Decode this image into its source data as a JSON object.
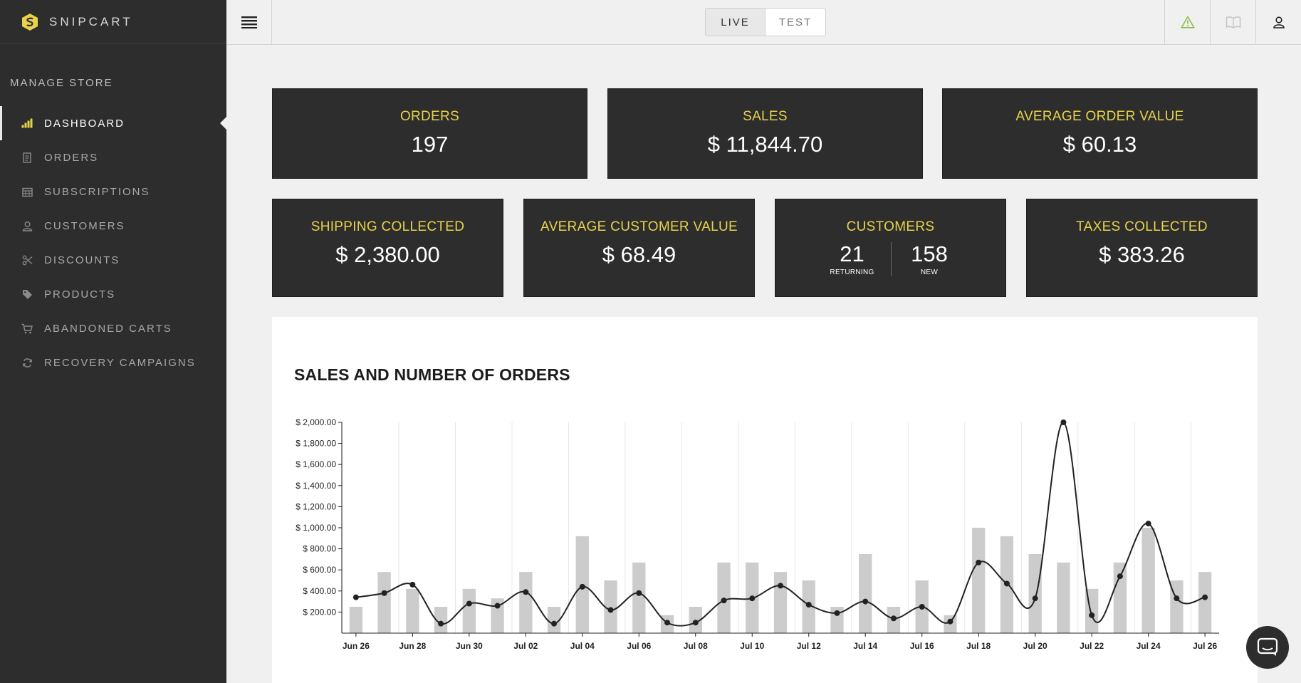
{
  "brand": {
    "name": "SNIPCART",
    "accent": "#e8d24a"
  },
  "sidebar": {
    "section_title": "MANAGE STORE",
    "items": [
      {
        "label": "DASHBOARD",
        "icon": "bar-chart-icon",
        "active": true
      },
      {
        "label": "ORDERS",
        "icon": "receipt-icon"
      },
      {
        "label": "SUBSCRIPTIONS",
        "icon": "calendar-icon"
      },
      {
        "label": "CUSTOMERS",
        "icon": "user-icon"
      },
      {
        "label": "DISCOUNTS",
        "icon": "scissors-icon"
      },
      {
        "label": "PRODUCTS",
        "icon": "tag-icon"
      },
      {
        "label": "ABANDONED CARTS",
        "icon": "cart-icon"
      },
      {
        "label": "RECOVERY CAMPAIGNS",
        "icon": "refresh-icon"
      }
    ]
  },
  "topbar": {
    "mode_live": "LIVE",
    "mode_test": "TEST",
    "selected_mode": "LIVE",
    "icons": [
      "warning-icon",
      "book-icon",
      "user-icon"
    ]
  },
  "stats": {
    "orders": {
      "label": "ORDERS",
      "value": "197"
    },
    "sales": {
      "label": "SALES",
      "value": "$ 11,844.70"
    },
    "aov": {
      "label": "AVERAGE ORDER VALUE",
      "value": "$ 60.13"
    },
    "shipping": {
      "label": "SHIPPING COLLECTED",
      "value": "$ 2,380.00"
    },
    "acv": {
      "label": "AVERAGE CUSTOMER VALUE",
      "value": "$ 68.49"
    },
    "customers": {
      "label": "CUSTOMERS",
      "returning": "21",
      "returning_label": "RETURNING",
      "new": "158",
      "new_label": "NEW"
    },
    "taxes": {
      "label": "TAXES COLLECTED",
      "value": "$ 383.26"
    }
  },
  "chart_title": "SALES AND NUMBER OF ORDERS",
  "chart_data": {
    "type": "bar",
    "title": "SALES AND NUMBER OF ORDERS",
    "x": [
      "Jun 26",
      "Jun 27",
      "Jun 28",
      "Jun 29",
      "Jun 30",
      "Jul 01",
      "Jul 02",
      "Jul 03",
      "Jul 04",
      "Jul 05",
      "Jul 06",
      "Jul 07",
      "Jul 08",
      "Jul 09",
      "Jul 10",
      "Jul 11",
      "Jul 12",
      "Jul 13",
      "Jul 14",
      "Jul 15",
      "Jul 16",
      "Jul 17",
      "Jul 18",
      "Jul 19",
      "Jul 20",
      "Jul 21",
      "Jul 22",
      "Jul 23",
      "Jul 24",
      "Jul 25",
      "Jul 26"
    ],
    "x_tick_labels": [
      "Jun 26",
      "Jun 28",
      "Jun 30",
      "Jul 02",
      "Jul 04",
      "Jul 06",
      "Jul 08",
      "Jul 10",
      "Jul 12",
      "Jul 14",
      "Jul 16",
      "Jul 18",
      "Jul 20",
      "Jul 22",
      "Jul 24",
      "Jul 26"
    ],
    "y_tick_labels": [
      "$ 200.00",
      "$ 400.00",
      "$ 600.00",
      "$ 800.00",
      "$ 1,000.00",
      "$ 1,200.00",
      "$ 1,400.00",
      "$ 1,600.00",
      "$ 1,800.00",
      "$ 2,000.00"
    ],
    "ylim": [
      0,
      2000
    ],
    "grid": "vertical",
    "series": [
      {
        "type": "bar",
        "color": "#cccccc",
        "values": [
          250,
          580,
          420,
          250,
          420,
          330,
          580,
          250,
          920,
          500,
          670,
          170,
          250,
          670,
          670,
          580,
          500,
          250,
          750,
          250,
          500,
          170,
          1000,
          920,
          750,
          670,
          420,
          670,
          1000,
          500,
          580
        ]
      },
      {
        "type": "line",
        "color": "#222222",
        "values": [
          340,
          380,
          460,
          90,
          280,
          260,
          390,
          90,
          440,
          220,
          380,
          100,
          100,
          310,
          330,
          450,
          270,
          190,
          300,
          140,
          250,
          110,
          670,
          470,
          330,
          2000,
          170,
          540,
          1040,
          330,
          340
        ]
      }
    ]
  }
}
